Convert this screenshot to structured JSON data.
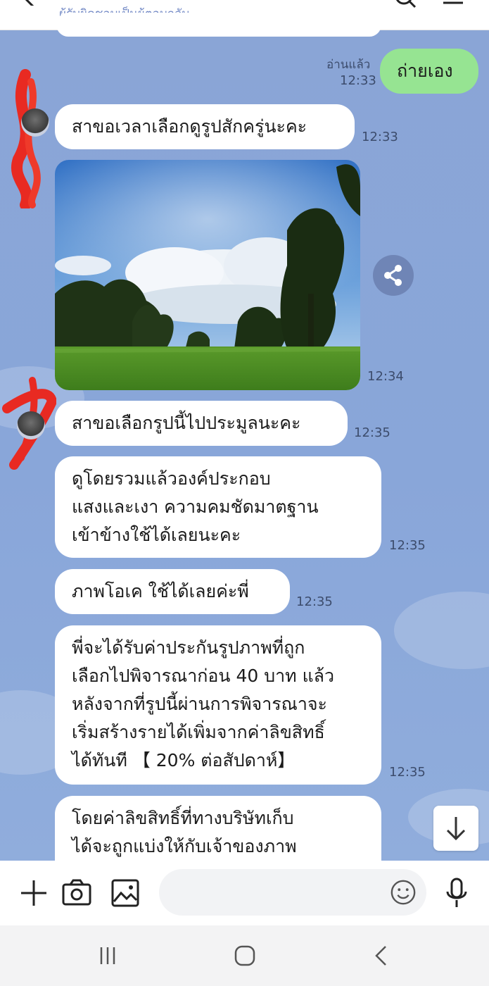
{
  "header": {
    "subtitle": "ผู้รับผิดชอบเป็นผู้ตอบกลับ"
  },
  "messages": {
    "m1": {
      "text": "ถ่ายเอง",
      "status": "อ่านแล้ว",
      "time": "12:33"
    },
    "m2": {
      "text": "สาขอเวลาเลือกดูรูปสักครู่นะคะ",
      "time": "12:33"
    },
    "m3": {
      "time": "12:34"
    },
    "m4": {
      "text": "สาขอเลือกรูปนี้ไปประมูลนะคะ",
      "time": "12:35"
    },
    "m5": {
      "lines": [
        "ดูโดยรวมแล้วองค์ประกอบ",
        "แสงและเงา ความคมชัดมาตฐาน",
        "เข้าข้างใช้ได้เลยนะคะ"
      ],
      "time": "12:35"
    },
    "m6": {
      "text": "ภาพโอเค ใช้ได้เลยค่ะพี่",
      "time": "12:35"
    },
    "m7": {
      "lines": [
        "พี่จะได้รับค่าประกันรูปภาพที่ถูก",
        "เลือกไปพิจารณาก่อน 40 บาท แล้ว",
        "หลังจากที่รูปนี้ผ่านการพิจารณาจะ",
        "เริ่มสร้างรายได้เพิ่มจากค่าลิขสิทธิ์",
        "ได้ทันที 【 20% ต่อสัปดาห์】"
      ],
      "time": "12:35"
    },
    "m8": {
      "lines": [
        "โดยค่าลิขสิทธิ์ที่ทางบริษัทเก็บ",
        "ได้จะถูกแบ่งให้กับเจ้าของภาพ"
      ]
    }
  },
  "icons": {
    "back": "chevron-left-icon",
    "search": "search-icon",
    "menu": "menu-icon",
    "share": "share-icon",
    "scroll_down": "arrow-down-icon",
    "add": "plus-icon",
    "camera": "camera-icon",
    "gallery": "image-icon",
    "emoji": "emoji-icon",
    "mic": "microphone-icon",
    "nav_recents": "recents-icon",
    "nav_home": "home-icon",
    "nav_back": "back-icon"
  },
  "colors": {
    "chat_background": "#8aa5d6",
    "sent_bubble": "#96e492",
    "received_bubble": "#ffffff",
    "subtitle_text": "#6f86c4"
  }
}
